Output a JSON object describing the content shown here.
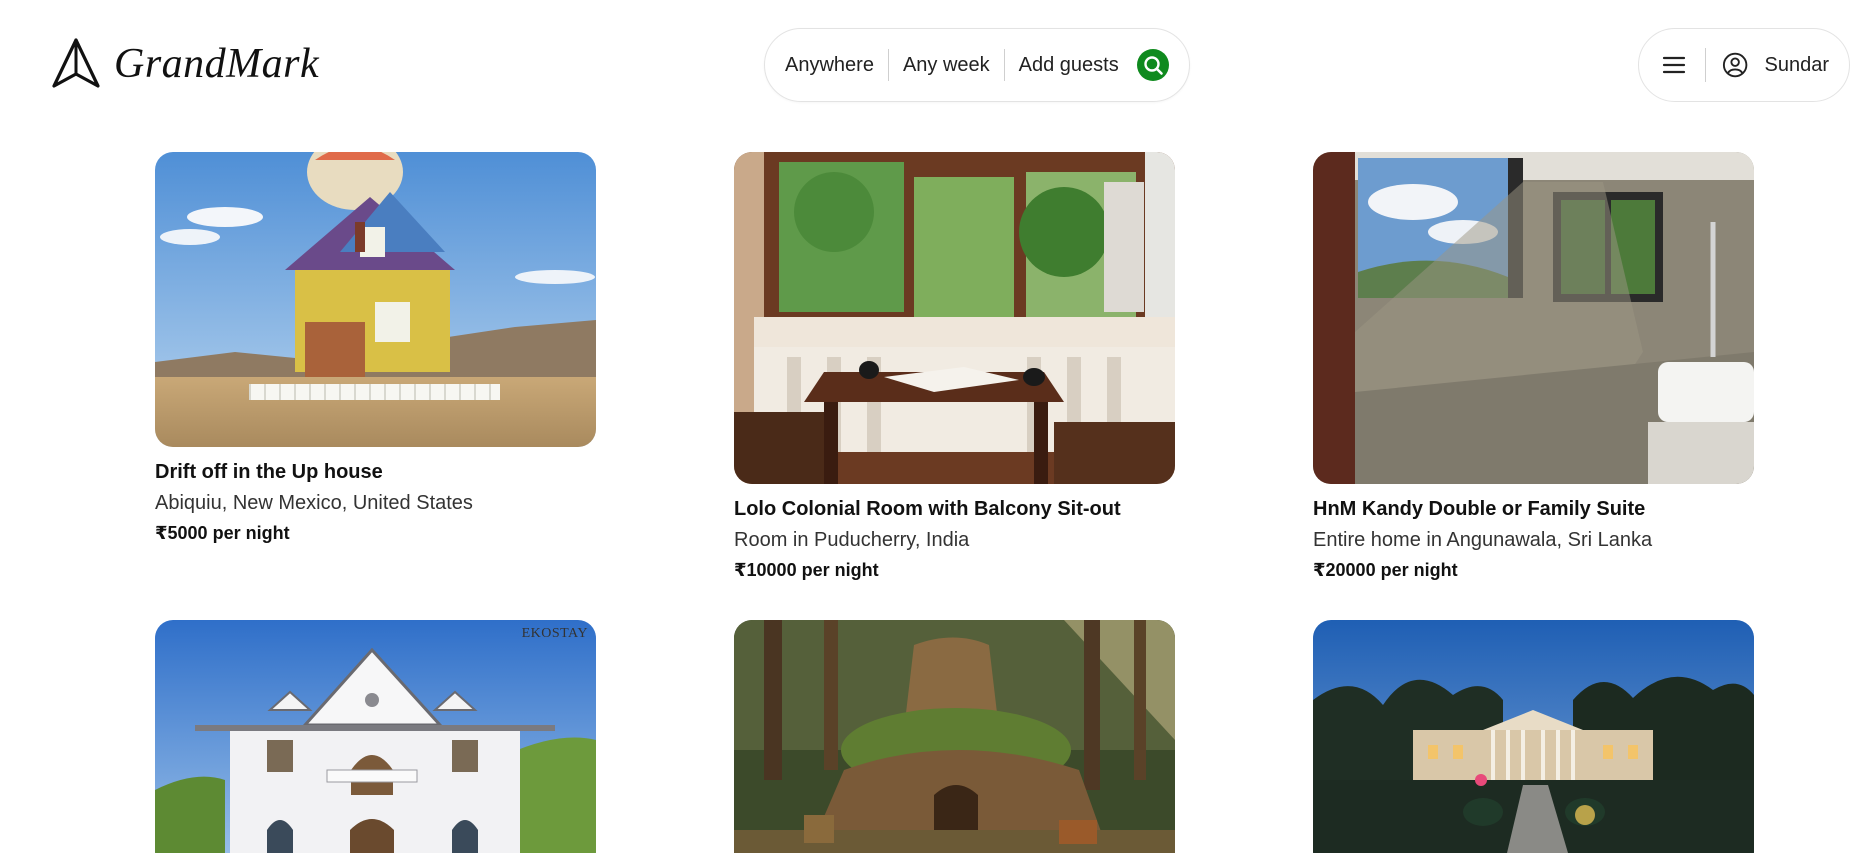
{
  "brand": {
    "name": "GrandMark",
    "icon": "tent-logo-icon"
  },
  "search": {
    "location": "Anywhere",
    "dates": "Any week",
    "guests": "Add guests",
    "button_icon": "search-icon",
    "accent": "#0f8a1e"
  },
  "user": {
    "menu_icon": "hamburger-icon",
    "avatar_icon": "user-circle-icon",
    "name": "Sundar"
  },
  "listings": [
    {
      "title": "Drift off in the Up house",
      "location": "Abiquiu, New Mexico, United States",
      "price": "₹5000 per night",
      "image": "up-house-photo"
    },
    {
      "title": "Lolo Colonial Room with Balcony Sit-out",
      "location": "Room in Puducherry, India",
      "price": "₹10000 per night",
      "image": "colonial-room-photo"
    },
    {
      "title": "HnM Kandy Double or Family Suite",
      "location": "Entire home in Angunawala, Sri Lanka",
      "price": "₹20000 per night",
      "image": "suite-bathroom-photo"
    },
    {
      "title": "",
      "location": "",
      "price": "",
      "image": "white-villa-photo",
      "watermark": "EKOSTAY"
    },
    {
      "title": "",
      "location": "",
      "price": "",
      "image": "shrek-swamp-photo"
    },
    {
      "title": "",
      "location": "",
      "price": "",
      "image": "mansion-night-photo"
    }
  ]
}
